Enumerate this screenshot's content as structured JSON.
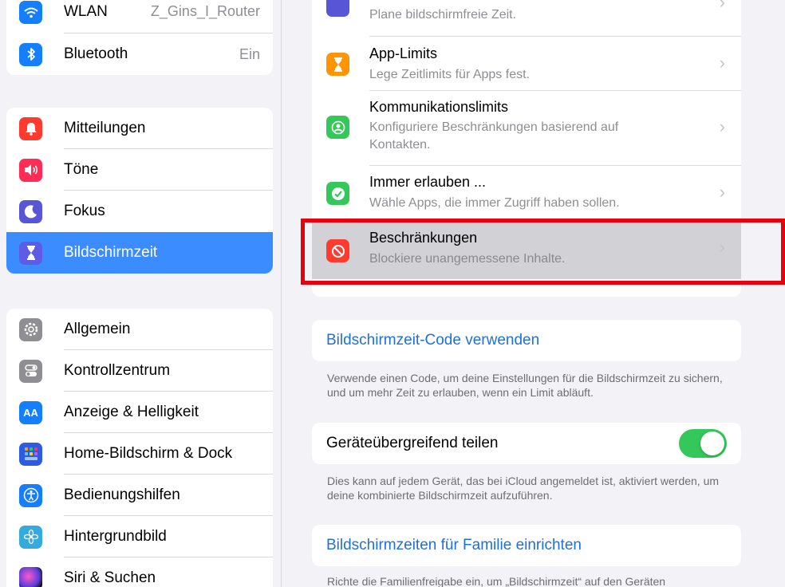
{
  "sidebar": {
    "wlan": {
      "label": "WLAN",
      "value": "Z_Gins_I_Router"
    },
    "bluetooth": {
      "label": "Bluetooth",
      "value": "Ein"
    },
    "group2": [
      {
        "label": "Mitteilungen",
        "icon": "bell-icon",
        "color": "#ff3b30"
      },
      {
        "label": "Töne",
        "icon": "speaker-icon",
        "color": "#ff2d55"
      },
      {
        "label": "Fokus",
        "icon": "moon-icon",
        "color": "#5856d6"
      },
      {
        "label": "Bildschirmzeit",
        "icon": "hourglass-icon",
        "color": "#5e5ce6",
        "selected": true
      }
    ],
    "group3": [
      {
        "label": "Allgemein",
        "icon": "gear-icon",
        "color": "#8e8e93"
      },
      {
        "label": "Kontrollzentrum",
        "icon": "toggles-icon",
        "color": "#8e8e93"
      },
      {
        "label": "Anzeige & Helligkeit",
        "icon": "text-size-icon",
        "color": "#147efb"
      },
      {
        "label": "Home-Bildschirm & Dock",
        "icon": "app-grid-icon",
        "color": "#2d5be3"
      },
      {
        "label": "Bedienungshilfen",
        "icon": "accessibility-icon",
        "color": "#147efb"
      },
      {
        "label": "Hintergrundbild",
        "icon": "flower-icon",
        "color": "#35aadc"
      },
      {
        "label": "Siri & Suchen",
        "icon": "siri-icon",
        "color": "#222222"
      }
    ]
  },
  "main": {
    "rows": [
      {
        "title": "",
        "subtitle": "Plane bildschirmfreie Zeit.",
        "icon": "downtime-icon",
        "color": "#5856d6"
      },
      {
        "title": "App-Limits",
        "subtitle": "Lege Zeitlimits für Apps fest.",
        "icon": "hourglass-icon",
        "color": "#ff9500"
      },
      {
        "title": "Kommunikationslimits",
        "subtitle": "Konfiguriere Beschränkungen basierend auf Kontakten.",
        "icon": "contact-icon",
        "color": "#34c759"
      },
      {
        "title": "Immer erlauben ...",
        "subtitle": "Wähle Apps, die immer Zugriff haben sollen.",
        "icon": "checkmark-badge-icon",
        "color": "#34c759"
      },
      {
        "title": "Beschränkungen",
        "subtitle": "Blockiere unangemessene Inhalte.",
        "icon": "no-entry-icon",
        "color": "#ff3b30",
        "highlighted": true
      }
    ],
    "code_link": "Bildschirmzeit-Code verwenden",
    "code_footer": "Verwende einen Code, um deine Einstellungen für die Bildschirmzeit zu sichern, und um mehr Zeit zu erlauben, wenn ein Limit abläuft.",
    "share_label": "Geräteübergreifend teilen",
    "share_on": true,
    "share_footer": "Dies kann auf jedem Gerät, das bei iCloud angemeldet ist, aktiviert werden, um deine kombinierte Bildschirmzeit aufzuführen.",
    "family_link": "Bildschirmzeiten für Familie einrichten",
    "family_footer": "Richte die Familienfreigabe ein, um „Bildschirmzeit“ auf den Geräten"
  },
  "annotation": {
    "color": "#e8000d"
  }
}
